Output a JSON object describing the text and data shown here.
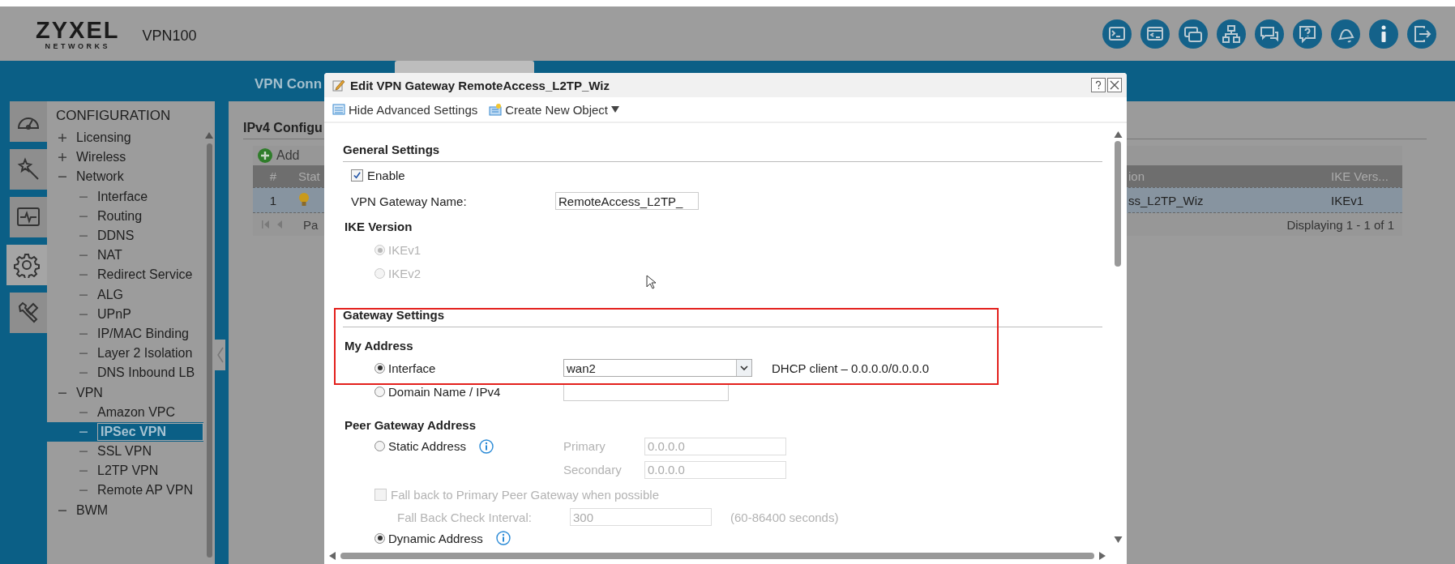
{
  "header": {
    "logo_top": "ZYXEL",
    "logo_bottom": "NETWORKS",
    "model": "VPN100"
  },
  "page_tab": "VPN Conn",
  "side_tabs": [
    {
      "kind": "dashboard",
      "selected": false
    },
    {
      "kind": "wizard",
      "selected": false
    },
    {
      "kind": "monitor",
      "selected": false
    },
    {
      "kind": "configuration",
      "selected": true
    },
    {
      "kind": "maintenance",
      "selected": false
    }
  ],
  "nav": {
    "title": "CONFIGURATION",
    "items": [
      {
        "label": "Licensing",
        "expanded": false,
        "selected": false
      },
      {
        "label": "Wireless",
        "expanded": false,
        "selected": false
      },
      {
        "label": "Network",
        "expanded": true,
        "selected": false,
        "children": [
          {
            "label": "Interface",
            "selected": false
          },
          {
            "label": "Routing",
            "selected": false
          },
          {
            "label": "DDNS",
            "selected": false
          },
          {
            "label": "NAT",
            "selected": false
          },
          {
            "label": "Redirect Service",
            "selected": false
          },
          {
            "label": "ALG",
            "selected": false
          },
          {
            "label": "UPnP",
            "selected": false
          },
          {
            "label": "IP/MAC Binding",
            "selected": false
          },
          {
            "label": "Layer 2 Isolation",
            "selected": false
          },
          {
            "label": "DNS Inbound LB",
            "selected": false
          }
        ]
      },
      {
        "label": "VPN",
        "expanded": true,
        "selected": false,
        "children": [
          {
            "label": "Amazon VPC",
            "selected": false
          },
          {
            "label": "IPSec VPN",
            "selected": true
          },
          {
            "label": "SSL VPN",
            "selected": false
          },
          {
            "label": "L2TP VPN",
            "selected": false
          },
          {
            "label": "Remote AP VPN",
            "selected": false
          }
        ]
      },
      {
        "label": "BWM",
        "expanded": true,
        "selected": false
      }
    ]
  },
  "content": {
    "heading": "IPv4 Configu",
    "add_label": "Add",
    "columns": [
      "#",
      "Stat",
      "ion",
      "IKE Vers..."
    ],
    "rows": [
      {
        "number": "1",
        "name": "ss_L2TP_Wiz",
        "ike_version": "IKEv1",
        "selected": true
      }
    ],
    "pager_label": "Pa",
    "summary": "Displaying 1 - 1 of 1"
  },
  "dialog": {
    "title": "Edit VPN Gateway RemoteAccess_L2TP_Wiz",
    "toolbar": [
      {
        "kind": "advanced",
        "label": "Hide Advanced Settings"
      },
      {
        "kind": "create",
        "label": "Create New Object"
      }
    ],
    "general": {
      "heading": "General Settings",
      "enable": {
        "label": "Enable",
        "checked": true
      },
      "name": {
        "label": "VPN Gateway Name:",
        "value": "RemoteAccess_L2TP_"
      },
      "ike": {
        "title": "IKE Version",
        "options": [
          {
            "label": "IKEv1",
            "selected": true,
            "disabled": true
          },
          {
            "label": "IKEv2",
            "selected": false,
            "disabled": true
          }
        ]
      }
    },
    "gateway": {
      "heading": "Gateway Settings",
      "my_address": {
        "title": "My Address",
        "interface": {
          "label": "Interface",
          "selected": true,
          "value": "wan2",
          "note": "DHCP client – 0.0.0.0/0.0.0.0"
        },
        "domain": {
          "label": "Domain Name / IPv4",
          "selected": false
        }
      },
      "peer": {
        "title": "Peer Gateway Address",
        "static": {
          "label": "Static Address",
          "selected": false,
          "disabled": true,
          "primary_label": "Primary",
          "primary_value": "0.0.0.0",
          "secondary_label": "Secondary",
          "secondary_value": "0.0.0.0"
        },
        "fallback": {
          "label": "Fall back to Primary Peer Gateway when possible",
          "checked": false,
          "disabled": true
        },
        "interval": {
          "label": "Fall Back Check Interval:",
          "value": "300",
          "hint": "(60-86400 seconds)",
          "disabled": true
        },
        "dynamic": {
          "label": "Dynamic Address",
          "selected": true
        }
      }
    }
  }
}
